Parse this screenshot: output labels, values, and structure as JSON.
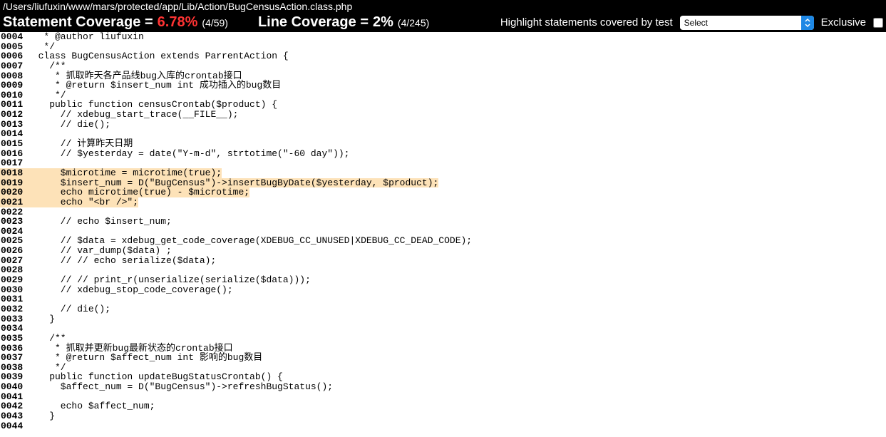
{
  "file_path": "/Users/liufuxin/www/mars/protected/app/Lib/Action/BugCensusAction.class.php",
  "coverage": {
    "statement_label": "Statement Coverage =",
    "statement_value": "6.78%",
    "statement_ratio": "(4/59)",
    "line_label": "Line Coverage =",
    "line_value": "2%",
    "line_ratio": "(4/245)"
  },
  "controls": {
    "highlight_label": "Highlight statements covered by test",
    "select_value": "Select",
    "exclusive_label": "Exclusive"
  },
  "highlighted_lines": [
    18,
    19,
    20,
    21
  ],
  "lines": [
    {
      "num": "0004",
      "code": "   * @author liufuxin"
    },
    {
      "num": "0005",
      "code": "   */"
    },
    {
      "num": "0006",
      "code": "  class BugCensusAction extends ParrentAction {"
    },
    {
      "num": "0007",
      "code": "    /**"
    },
    {
      "num": "0008",
      "code": "     * 抓取昨天各产品线bug入库的crontab接口"
    },
    {
      "num": "0009",
      "code": "     * @return $insert_num int 成功插入的bug数目"
    },
    {
      "num": "0010",
      "code": "     */"
    },
    {
      "num": "0011",
      "code": "    public function censusCrontab($product) {"
    },
    {
      "num": "0012",
      "code": "      // xdebug_start_trace(__FILE__);"
    },
    {
      "num": "0013",
      "code": "      // die();"
    },
    {
      "num": "0014",
      "code": ""
    },
    {
      "num": "0015",
      "code": "      // 计算昨天日期"
    },
    {
      "num": "0016",
      "code": "      // $yesterday = date(\"Y-m-d\", strtotime(\"-60 day\"));"
    },
    {
      "num": "0017",
      "code": ""
    },
    {
      "num": "0018",
      "code": "      $microtime = microtime(true);"
    },
    {
      "num": "0019",
      "code": "      $insert_num = D(\"BugCensus\")->insertBugByDate($yesterday, $product);"
    },
    {
      "num": "0020",
      "code": "      echo microtime(true) - $microtime;"
    },
    {
      "num": "0021",
      "code": "      echo \"<br />\";"
    },
    {
      "num": "0022",
      "code": ""
    },
    {
      "num": "0023",
      "code": "      // echo $insert_num;"
    },
    {
      "num": "0024",
      "code": ""
    },
    {
      "num": "0025",
      "code": "      // $data = xdebug_get_code_coverage(XDEBUG_CC_UNUSED|XDEBUG_CC_DEAD_CODE);"
    },
    {
      "num": "0026",
      "code": "      // var_dump($data) ;"
    },
    {
      "num": "0027",
      "code": "      // // echo serialize($data);"
    },
    {
      "num": "0028",
      "code": ""
    },
    {
      "num": "0029",
      "code": "      // // print_r(unserialize(serialize($data)));"
    },
    {
      "num": "0030",
      "code": "      // xdebug_stop_code_coverage();"
    },
    {
      "num": "0031",
      "code": ""
    },
    {
      "num": "0032",
      "code": "      // die();"
    },
    {
      "num": "0033",
      "code": "    }"
    },
    {
      "num": "0034",
      "code": ""
    },
    {
      "num": "0035",
      "code": "    /**"
    },
    {
      "num": "0036",
      "code": "     * 抓取并更新bug最新状态的crontab接口"
    },
    {
      "num": "0037",
      "code": "     * @return $affect_num int 影响的bug数目"
    },
    {
      "num": "0038",
      "code": "     */"
    },
    {
      "num": "0039",
      "code": "    public function updateBugStatusCrontab() {"
    },
    {
      "num": "0040",
      "code": "      $affect_num = D(\"BugCensus\")->refreshBugStatus();"
    },
    {
      "num": "0041",
      "code": ""
    },
    {
      "num": "0042",
      "code": "      echo $affect_num;"
    },
    {
      "num": "0043",
      "code": "    }"
    },
    {
      "num": "0044",
      "code": ""
    }
  ]
}
